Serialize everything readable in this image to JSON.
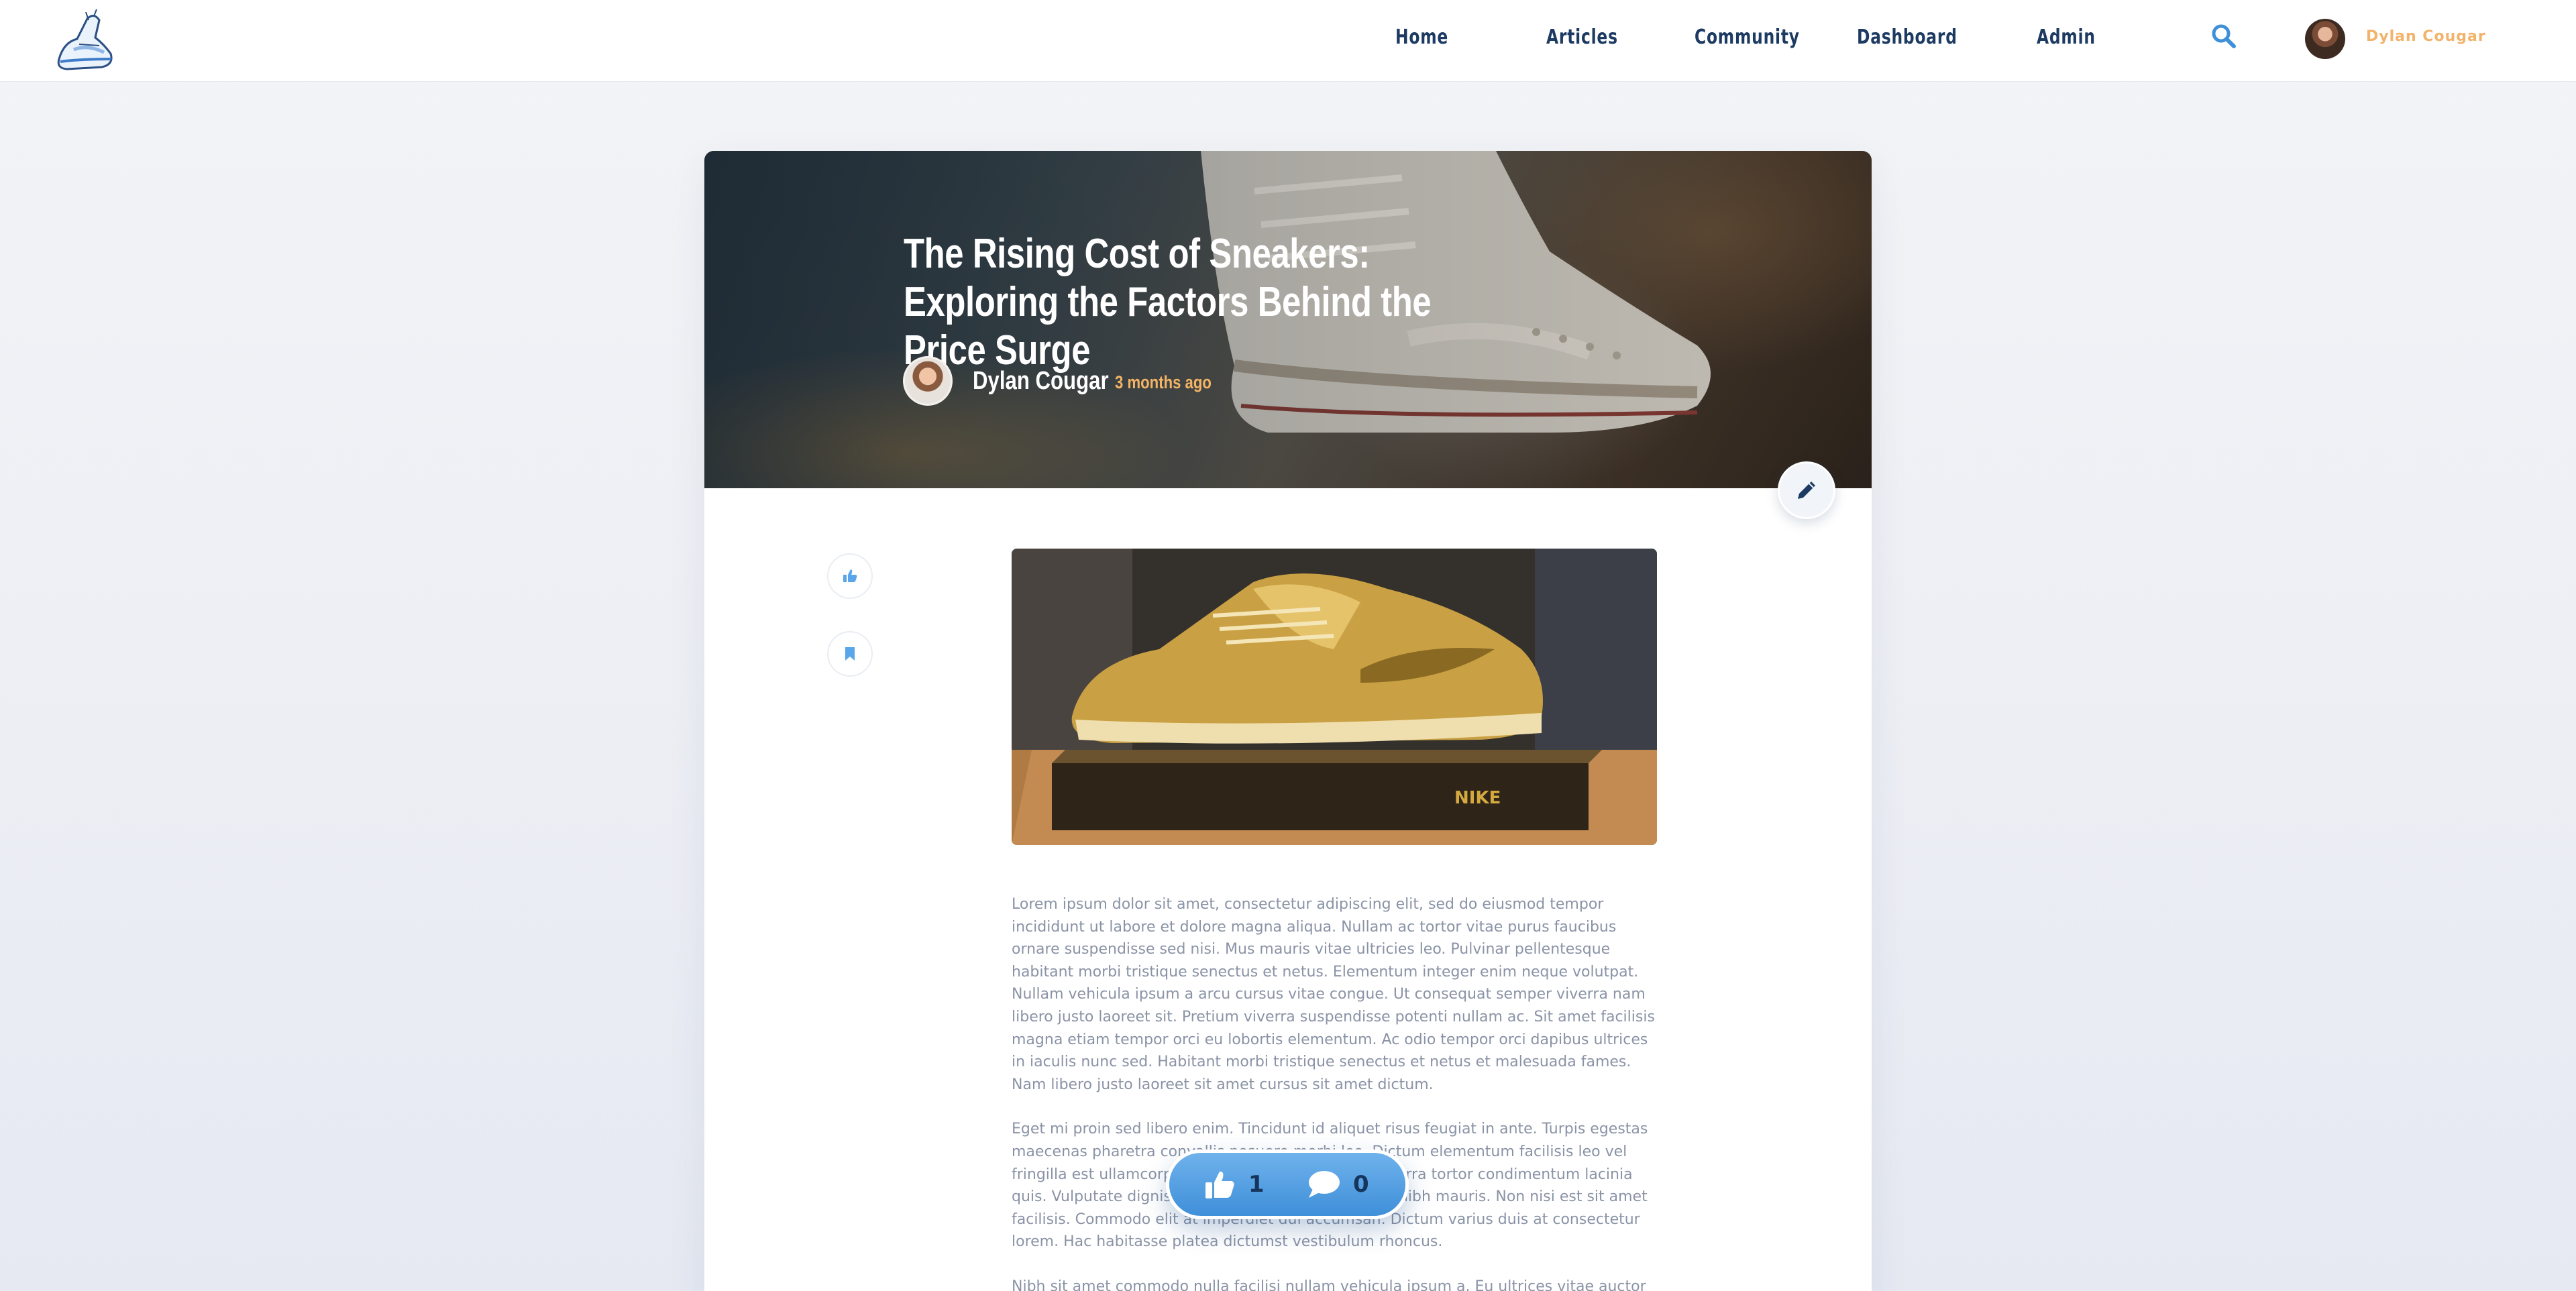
{
  "nav": {
    "items": [
      "Home",
      "Articles",
      "Community",
      "Dashboard",
      "Admin"
    ],
    "user_name": "Dylan Cougar"
  },
  "article": {
    "title": "The Rising Cost of Sneakers: Exploring the Factors Behind the Price Surge",
    "author": "Dylan Cougar",
    "posted": "3 months ago",
    "paragraphs": [
      "Lorem ipsum dolor sit amet, consectetur adipiscing elit, sed do eiusmod tempor incididunt ut labore et dolore magna aliqua. Nullam ac tortor vitae purus faucibus ornare suspendisse sed nisi. Mus mauris vitae ultricies leo. Pulvinar pellentesque habitant morbi tristique senectus et netus. Elementum integer enim neque volutpat. Nullam vehicula ipsum a arcu cursus vitae congue. Ut consequat semper viverra nam libero justo laoreet sit. Pretium viverra suspendisse potenti nullam ac. Sit amet facilisis magna etiam tempor orci eu lobortis elementum. Ac odio tempor orci dapibus ultrices in iaculis nunc sed. Habitant morbi tristique senectus et netus et malesuada fames. Nam libero justo laoreet sit amet cursus sit amet dictum.",
      "Eget mi proin sed libero enim. Tincidunt id aliquet risus feugiat in ante. Turpis egestas maecenas pharetra convallis posuere morbi leo. Dictum elementum facilisis leo vel fringilla est ullamcorper eget nulla facilisi etiam. Viverra tortor condimentum lacinia quis. Vulputate dignissim suspendisse in est ante in nibh mauris. Non nisi est sit amet facilisis. Commodo elit at imperdiet dui accumsan. Dictum varius duis at consectetur lorem. Hac habitasse platea dictumst vestibulum rhoncus.",
      "Nibh sit amet commodo nulla facilisi nullam vehicula ipsum a. Eu ultrices vitae auctor eu"
    ]
  },
  "reactions": {
    "likes": "1",
    "comments": "0"
  },
  "colors": {
    "nav_text": "#1c3a62",
    "accent_orange": "#f3b466",
    "accent_blue": "#4a9be0"
  },
  "icons": [
    "logo-icon",
    "search-icon",
    "edit-icon",
    "thumbs-up-icon",
    "bookmark-icon",
    "comment-icon"
  ]
}
